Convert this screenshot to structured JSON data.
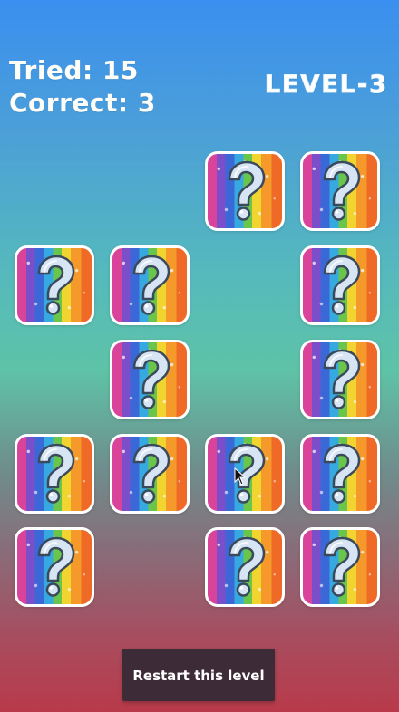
{
  "header": {
    "tried_label": "Tried: 15",
    "correct_label": "Correct: 3",
    "level_label": "LEVEL-3"
  },
  "board": {
    "card_icon": "question-mark-icon",
    "card_colors": [
      "#d9449a",
      "#7a4fc9",
      "#3a68d6",
      "#35a9e0",
      "#6ac64b",
      "#f2d430",
      "#f59a2a",
      "#ef6a26"
    ],
    "rows": [
      [
        false,
        false,
        true,
        true
      ],
      [
        true,
        true,
        false,
        true
      ],
      [
        false,
        true,
        false,
        true
      ],
      [
        true,
        true,
        true,
        true
      ],
      [
        true,
        false,
        true,
        true
      ]
    ]
  },
  "footer": {
    "restart_label": "Restart this level"
  }
}
